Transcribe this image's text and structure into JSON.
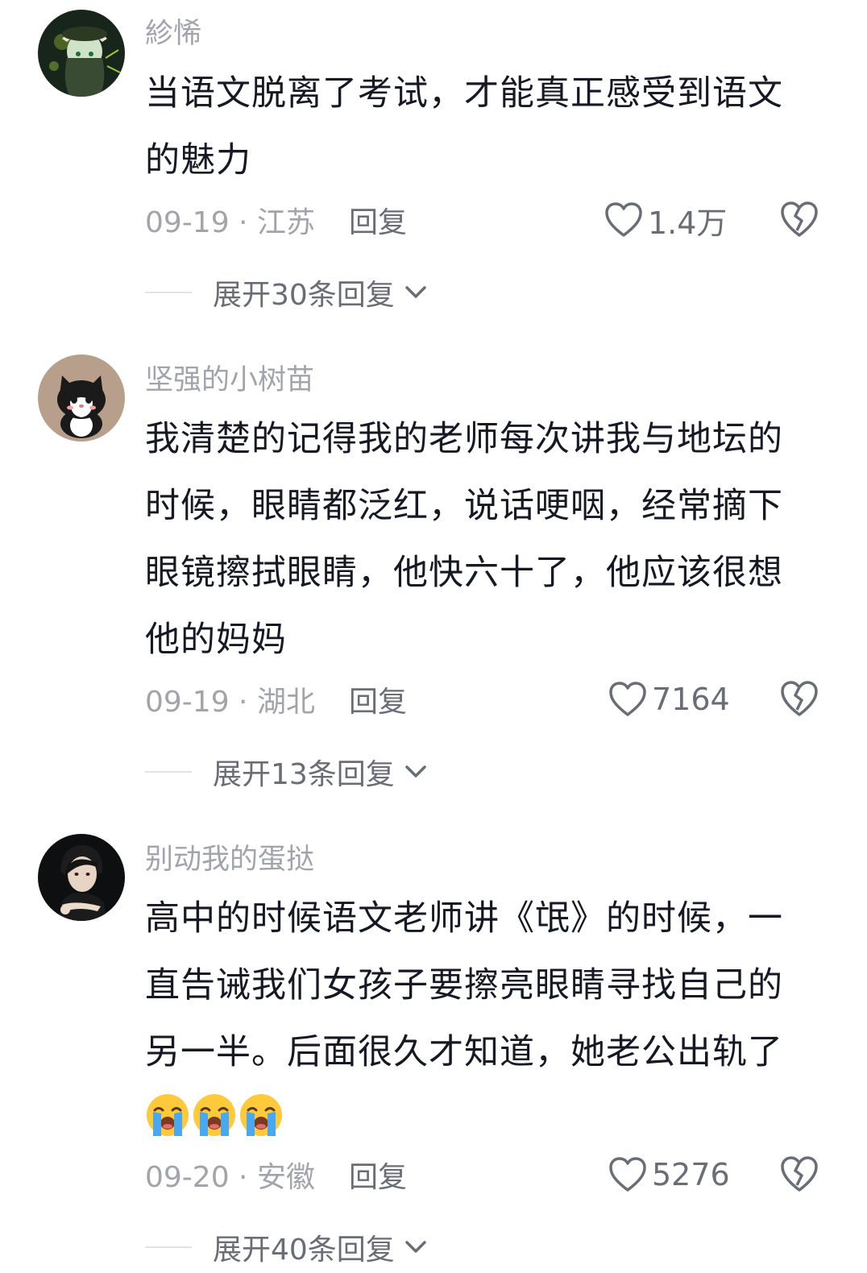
{
  "comments": [
    {
      "username": "紾悕",
      "lines": [
        "当语文脱离了考试，才能真正感受到语文",
        "的魅力"
      ],
      "date_location": "09-19 · 江苏",
      "reply_label": "回复",
      "likes": "1.4万",
      "expand_label": "展开30条回复"
    },
    {
      "username": "坚强的小树苗",
      "lines": [
        "我清楚的记得我的老师每次讲我与地坛的",
        "时候，眼睛都泛红，说话哽咽，经常摘下",
        "眼镜擦拭眼睛，他快六十了，他应该很想",
        "他的妈妈"
      ],
      "date_location": "09-19 · 湖北",
      "reply_label": "回复",
      "likes": "7164",
      "expand_label": "展开13条回复"
    },
    {
      "username": "别动我的蛋挞",
      "lines": [
        "高中的时候语文老师讲《氓》的时候，一",
        "直告诫我们女孩子要擦亮眼睛寻找自己的",
        "另一半。后面很久才知道，她老公出轨了"
      ],
      "emojis": [
        "loudly-crying-emoji",
        "loudly-crying-emoji",
        "loudly-crying-emoji"
      ],
      "date_location": "09-20 · 安徽",
      "reply_label": "回复",
      "likes": "5276",
      "expand_label": "展开40条回复"
    }
  ],
  "colors": {
    "text": "#161823",
    "muted": "#a3a4ab",
    "secondary": "#6b6d76",
    "divider": "#e3e3e6"
  },
  "icons": {
    "like": "heart-outline-icon",
    "dislike": "broken-heart-icon",
    "expand": "chevron-down-icon"
  }
}
